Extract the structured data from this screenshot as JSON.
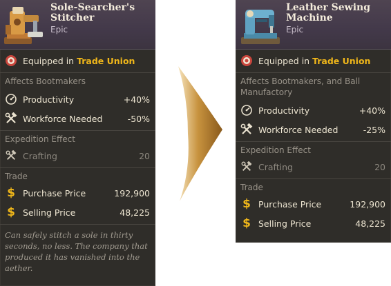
{
  "left_card": {
    "item_name": "Sole-Searcher's Stitcher",
    "rarity": "Epic",
    "equipped_prefix": "Equipped in",
    "equipped_location": "Trade Union",
    "affects": "Affects Bootmakers",
    "stats": [
      {
        "label": "Productivity",
        "value": "+40%",
        "icon": "gauge-icon"
      },
      {
        "label": "Workforce Needed",
        "value": "-50%",
        "icon": "hammer-wrench-icon"
      }
    ],
    "expedition_title": "Expedition Effect",
    "expedition": {
      "label": "Crafting",
      "value": "20",
      "icon": "hammer-wrench-icon"
    },
    "trade_title": "Trade",
    "trade": [
      {
        "label": "Purchase Price",
        "value": "192,900",
        "icon": "dollar-icon"
      },
      {
        "label": "Selling Price",
        "value": "48,225",
        "icon": "dollar-icon"
      }
    ],
    "description": "Can safely stitch a sole in thirty seconds, no less. The company that produced it has vanished into the aether."
  },
  "right_card": {
    "item_name": "Leather Sewing Machine",
    "rarity": "Epic",
    "equipped_prefix": "Equipped in",
    "equipped_location": "Trade Union",
    "affects": "Affects Bootmakers, and Ball Manufactory",
    "stats": [
      {
        "label": "Productivity",
        "value": "+40%",
        "icon": "gauge-icon"
      },
      {
        "label": "Workforce Needed",
        "value": "-25%",
        "icon": "hammer-wrench-icon"
      }
    ],
    "expedition_title": "Expedition Effect",
    "expedition": {
      "label": "Crafting",
      "value": "20",
      "icon": "hammer-wrench-icon"
    },
    "trade_title": "Trade",
    "trade": [
      {
        "label": "Purchase Price",
        "value": "192,900",
        "icon": "dollar-icon"
      },
      {
        "label": "Selling Price",
        "value": "48,225",
        "icon": "dollar-icon"
      }
    ]
  },
  "colors": {
    "panel": "#2f2d29",
    "header": "#4a3f4d",
    "union_gold": "#f0b71a",
    "arrow": "#b07a2c"
  }
}
